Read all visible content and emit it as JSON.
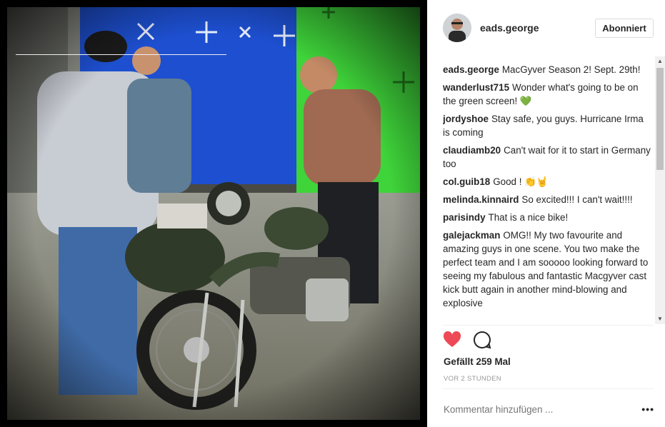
{
  "post": {
    "image_alt": "Photo: actors on a motorcycle with sidecar in front of blue and green screens"
  },
  "header": {
    "username": "eads.george",
    "follow_label": "Abonniert",
    "avatar_icon": "profile-photo"
  },
  "comments": [
    {
      "author": "eads.george",
      "text": "MacGyver Season 2! Sept. 29th!"
    },
    {
      "author": "wanderlust715",
      "text": "Wonder what's going to be on the green screen! 💚"
    },
    {
      "author": "jordyshoe",
      "text": "Stay safe, you guys. Hurricane Irma is coming"
    },
    {
      "author": "claudiamb20",
      "text": "Can't wait for it to start in Germany too"
    },
    {
      "author": "col.guib18",
      "text": "Good ! 👏🤘"
    },
    {
      "author": "melinda.kinnaird",
      "text": "So excited!!! I can't wait!!!!"
    },
    {
      "author": "parisindy",
      "text": "That is a nice bike!"
    },
    {
      "author": "galejackman",
      "text": "OMG!! My two favourite and amazing guys in one scene. You two make the perfect team and I am sooooo looking forward to seeing my fabulous and fantastic Macgyver cast kick butt again in another mind-blowing and explosive"
    }
  ],
  "actions": {
    "like_icon": "heart-icon",
    "comment_icon": "comment-bubble-icon",
    "like_color": "#ed4956"
  },
  "likes_text": "Gefällt 259 Mal",
  "timestamp": "VOR 2 STUNDEN",
  "comment_input": {
    "placeholder": "Kommentar hinzufügen ...",
    "more_label": "•••"
  }
}
